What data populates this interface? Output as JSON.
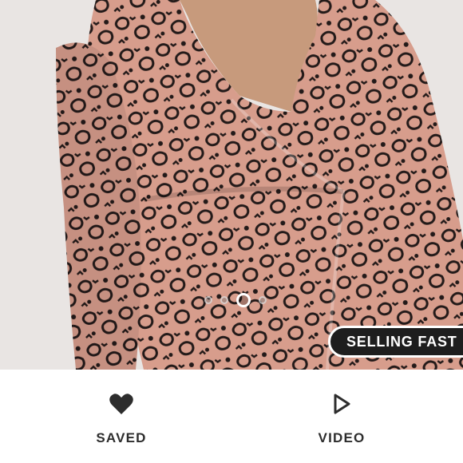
{
  "product_image": {
    "alt": "Woman wearing pink and black leopard print wrap dress",
    "carousel": {
      "count": 5,
      "active_index": 2
    }
  },
  "badge": {
    "text": "SELLING FAST"
  },
  "actions": {
    "saved": {
      "label": "SAVED",
      "icon": "heart-icon"
    },
    "video": {
      "label": "VIDEO",
      "icon": "play-icon"
    }
  },
  "colors": {
    "print_base": "#d79d8c",
    "print_spots": "#231a19",
    "badge_bg": "#1e1e1e",
    "text_dark": "#2d2d2d"
  }
}
